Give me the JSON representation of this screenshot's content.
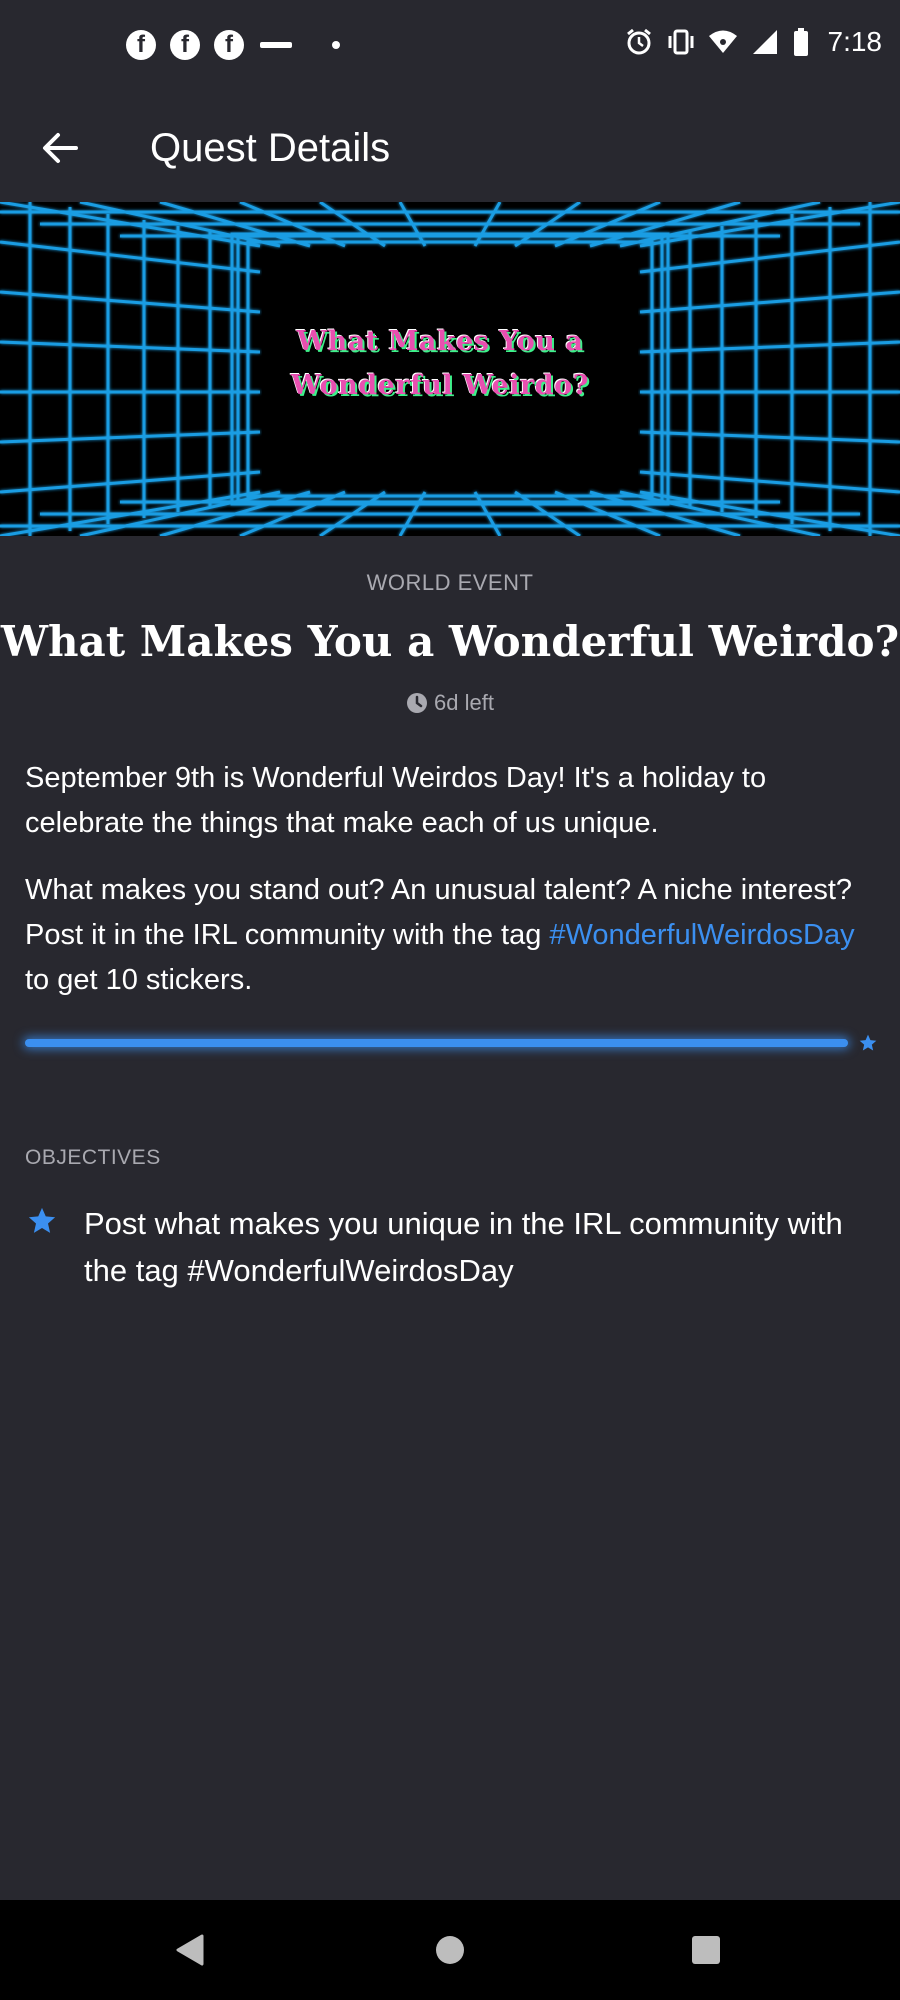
{
  "status_bar": {
    "time": "7:18",
    "notification_icons": [
      "facebook-icon",
      "facebook-icon",
      "facebook-icon",
      "dash-icon",
      "dot-icon"
    ],
    "system_icons": [
      "alarm-icon",
      "vibrate-icon",
      "wifi-icon",
      "signal-icon",
      "battery-icon"
    ]
  },
  "app_bar": {
    "title": "Quest Details",
    "back_icon": "arrow-left-icon"
  },
  "banner": {
    "text_line1": "What Makes You a",
    "text_line2": "Wonderful Weirdo?",
    "colors": {
      "grid": "#1ea6f0",
      "text": "#e84fb0",
      "text_outline": "#3ef08a"
    }
  },
  "quest": {
    "event_type": "WORLD EVENT",
    "title": "What Makes You a Wonderful Weirdo?",
    "time_left": "6d left",
    "description_1": "September 9th is Wonderful Weirdos Day! It's a holiday to celebrate the things that make each of us unique.",
    "description_2_before": "What makes you stand out? An unusual talent? A niche interest? Post it in the IRL community with the tag ",
    "description_2_hashtag": "#WonderfulWeirdosDay",
    "description_2_after": " to get 10 stickers.",
    "progress": 1.0
  },
  "objectives": {
    "label": "OBJECTIVES",
    "items": [
      {
        "icon": "star-icon",
        "text": "Post what makes you unique in the IRL community with the tag #WonderfulWeirdosDay"
      }
    ]
  },
  "nav_bar": {
    "buttons": [
      "back-triangle-icon",
      "home-circle-icon",
      "recents-square-icon"
    ]
  },
  "colors": {
    "background": "#28282f",
    "accent": "#3b8ff0",
    "muted_text": "#a9a9b0"
  }
}
